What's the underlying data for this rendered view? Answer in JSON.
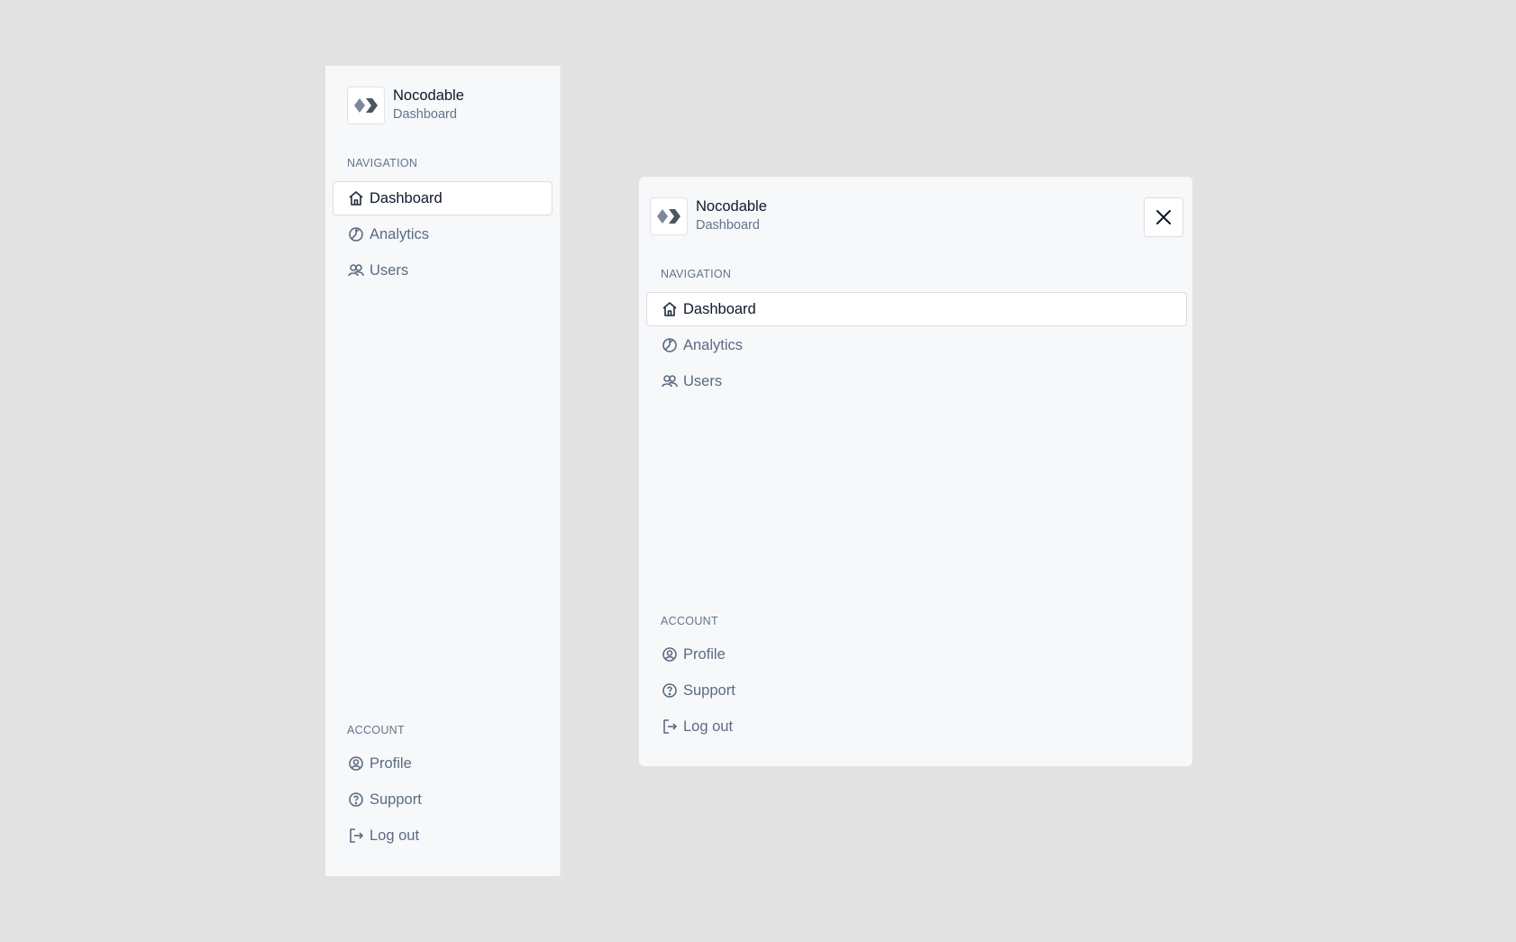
{
  "brand": {
    "name": "Nocodable",
    "subtitle": "Dashboard"
  },
  "navigation": {
    "label": "NAVIGATION",
    "items": [
      {
        "label": "Dashboard",
        "icon": "home-icon",
        "active": true
      },
      {
        "label": "Analytics",
        "icon": "pie-chart-icon",
        "active": false
      },
      {
        "label": "Users",
        "icon": "users-icon",
        "active": false
      }
    ]
  },
  "account": {
    "label": "ACCOUNT",
    "items": [
      {
        "label": "Profile",
        "icon": "user-circle-icon"
      },
      {
        "label": "Support",
        "icon": "help-circle-icon"
      },
      {
        "label": "Log out",
        "icon": "logout-icon"
      }
    ]
  },
  "colors": {
    "background": "#e2e2e2",
    "panel": "#f6f8fa",
    "text_primary": "#0f172a",
    "text_muted": "#5b6b80",
    "border": "#d9dde3"
  }
}
